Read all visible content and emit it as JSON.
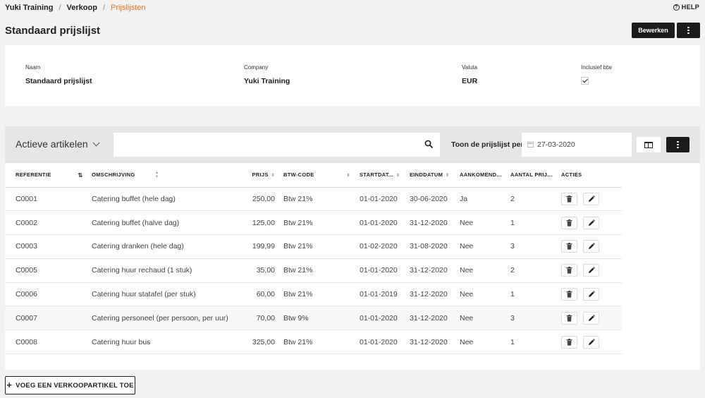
{
  "breadcrumb": {
    "items": [
      "Yuki Training",
      "Verkoop",
      "Prijslijsten"
    ],
    "separator": "/"
  },
  "help_label": "HELP",
  "page_title": "Standaard prijslijst",
  "header_actions": {
    "edit_label": "Bewerken",
    "more_icon": "vertical-dots-icon"
  },
  "info": {
    "naam": {
      "label": "Naam",
      "value": "Standaard prijslijst"
    },
    "company": {
      "label": "Company",
      "value": "Yuki Training"
    },
    "valuta": {
      "label": "Valuta",
      "value": "EUR"
    },
    "inclusief_btw": {
      "label": "Inclusief btw",
      "checked": true
    }
  },
  "toolbar": {
    "view_label": "Actieve artikelen",
    "search_placeholder": "",
    "date_label": "Toon de prijslijst per",
    "date_value": "27-03-2020"
  },
  "table": {
    "headers": {
      "referentie": "REFERENTIE",
      "omschrijving": "OMSCHRIJVING",
      "prijs": "PRIJS",
      "btw_code": "BTW-CODE",
      "startdatum": "STARTDAT...",
      "einddatum": "EINDDATUM",
      "aankomend": "AANKOMEND...",
      "aantal_prijzen": "AANTAL PRIJ...",
      "acties": "ACTIES"
    },
    "rows": [
      {
        "ref": "C0001",
        "desc": "Catering buffet (hele dag)",
        "price": "250,00",
        "vat": "Btw 21%",
        "start": "01-01-2020",
        "end": "30-06-2020",
        "upcoming": "Ja",
        "count": "2"
      },
      {
        "ref": "C0002",
        "desc": "Catering buffet (halve dag)",
        "price": "125,00",
        "vat": "Btw 21%",
        "start": "01-01-2020",
        "end": "31-12-2020",
        "upcoming": "Nee",
        "count": "1"
      },
      {
        "ref": "C0003",
        "desc": "Catering dranken (hele dag)",
        "price": "199,99",
        "vat": "Btw 21%",
        "start": "01-02-2020",
        "end": "31-08-2020",
        "upcoming": "Nee",
        "count": "3"
      },
      {
        "ref": "C0005",
        "desc": "Catering huur rechaud (1 stuk)",
        "price": "35,00",
        "vat": "Btw 21%",
        "start": "01-01-2020",
        "end": "31-12-2020",
        "upcoming": "Nee",
        "count": "2"
      },
      {
        "ref": "C0006",
        "desc": "Catering huur statafel (per stuk)",
        "price": "60,00",
        "vat": "Btw 21%",
        "start": "01-01-2019",
        "end": "31-12-2020",
        "upcoming": "Nee",
        "count": "1"
      },
      {
        "ref": "C0007",
        "desc": "Catering personeel (per persoon, per uur)",
        "price": "70,00",
        "vat": "Btw 9%",
        "start": "01-01-2020",
        "end": "31-12-2020",
        "upcoming": "Nee",
        "count": "3"
      },
      {
        "ref": "C0008",
        "desc": "Catering huur bus",
        "price": "325,00",
        "vat": "Btw 21%",
        "start": "01-01-2020",
        "end": "31-12-2020",
        "upcoming": "Nee",
        "count": "1"
      }
    ]
  },
  "add_button_label": "VOEG EEN VERKOOPARTIKEL TOE",
  "colors": {
    "accent": "#e8732b",
    "dark_button": "#1c1c1c",
    "background": "#f2f2f2"
  }
}
